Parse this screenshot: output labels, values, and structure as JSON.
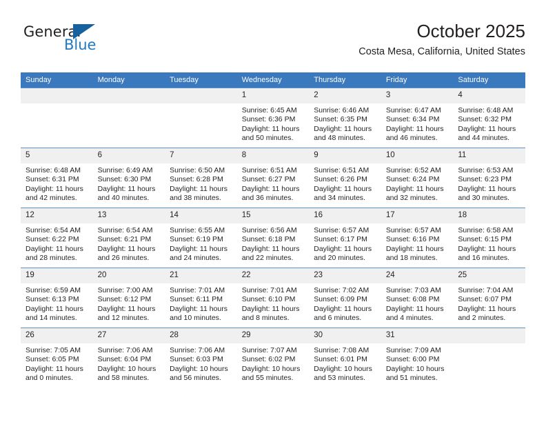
{
  "brand": {
    "name_top": "General",
    "name_bottom": "Blue",
    "triangle_color": "#17619f",
    "blue_color": "#1f7ac4"
  },
  "header": {
    "title": "October 2025",
    "subtitle": "Costa Mesa, California, United States",
    "header_bg": "#3a79bd",
    "daynum_bg": "#f0f0f0"
  },
  "weekday_headers": [
    "Sunday",
    "Monday",
    "Tuesday",
    "Wednesday",
    "Thursday",
    "Friday",
    "Saturday"
  ],
  "weeks": [
    [
      {
        "day": "",
        "sunrise": "",
        "sunset": "",
        "daylight_line1": "",
        "daylight_line2": ""
      },
      {
        "day": "",
        "sunrise": "",
        "sunset": "",
        "daylight_line1": "",
        "daylight_line2": ""
      },
      {
        "day": "",
        "sunrise": "",
        "sunset": "",
        "daylight_line1": "",
        "daylight_line2": ""
      },
      {
        "day": "1",
        "sunrise": "Sunrise: 6:45 AM",
        "sunset": "Sunset: 6:36 PM",
        "daylight_line1": "Daylight: 11 hours",
        "daylight_line2": "and 50 minutes."
      },
      {
        "day": "2",
        "sunrise": "Sunrise: 6:46 AM",
        "sunset": "Sunset: 6:35 PM",
        "daylight_line1": "Daylight: 11 hours",
        "daylight_line2": "and 48 minutes."
      },
      {
        "day": "3",
        "sunrise": "Sunrise: 6:47 AM",
        "sunset": "Sunset: 6:34 PM",
        "daylight_line1": "Daylight: 11 hours",
        "daylight_line2": "and 46 minutes."
      },
      {
        "day": "4",
        "sunrise": "Sunrise: 6:48 AM",
        "sunset": "Sunset: 6:32 PM",
        "daylight_line1": "Daylight: 11 hours",
        "daylight_line2": "and 44 minutes."
      }
    ],
    [
      {
        "day": "5",
        "sunrise": "Sunrise: 6:48 AM",
        "sunset": "Sunset: 6:31 PM",
        "daylight_line1": "Daylight: 11 hours",
        "daylight_line2": "and 42 minutes."
      },
      {
        "day": "6",
        "sunrise": "Sunrise: 6:49 AM",
        "sunset": "Sunset: 6:30 PM",
        "daylight_line1": "Daylight: 11 hours",
        "daylight_line2": "and 40 minutes."
      },
      {
        "day": "7",
        "sunrise": "Sunrise: 6:50 AM",
        "sunset": "Sunset: 6:28 PM",
        "daylight_line1": "Daylight: 11 hours",
        "daylight_line2": "and 38 minutes."
      },
      {
        "day": "8",
        "sunrise": "Sunrise: 6:51 AM",
        "sunset": "Sunset: 6:27 PM",
        "daylight_line1": "Daylight: 11 hours",
        "daylight_line2": "and 36 minutes."
      },
      {
        "day": "9",
        "sunrise": "Sunrise: 6:51 AM",
        "sunset": "Sunset: 6:26 PM",
        "daylight_line1": "Daylight: 11 hours",
        "daylight_line2": "and 34 minutes."
      },
      {
        "day": "10",
        "sunrise": "Sunrise: 6:52 AM",
        "sunset": "Sunset: 6:24 PM",
        "daylight_line1": "Daylight: 11 hours",
        "daylight_line2": "and 32 minutes."
      },
      {
        "day": "11",
        "sunrise": "Sunrise: 6:53 AM",
        "sunset": "Sunset: 6:23 PM",
        "daylight_line1": "Daylight: 11 hours",
        "daylight_line2": "and 30 minutes."
      }
    ],
    [
      {
        "day": "12",
        "sunrise": "Sunrise: 6:54 AM",
        "sunset": "Sunset: 6:22 PM",
        "daylight_line1": "Daylight: 11 hours",
        "daylight_line2": "and 28 minutes."
      },
      {
        "day": "13",
        "sunrise": "Sunrise: 6:54 AM",
        "sunset": "Sunset: 6:21 PM",
        "daylight_line1": "Daylight: 11 hours",
        "daylight_line2": "and 26 minutes."
      },
      {
        "day": "14",
        "sunrise": "Sunrise: 6:55 AM",
        "sunset": "Sunset: 6:19 PM",
        "daylight_line1": "Daylight: 11 hours",
        "daylight_line2": "and 24 minutes."
      },
      {
        "day": "15",
        "sunrise": "Sunrise: 6:56 AM",
        "sunset": "Sunset: 6:18 PM",
        "daylight_line1": "Daylight: 11 hours",
        "daylight_line2": "and 22 minutes."
      },
      {
        "day": "16",
        "sunrise": "Sunrise: 6:57 AM",
        "sunset": "Sunset: 6:17 PM",
        "daylight_line1": "Daylight: 11 hours",
        "daylight_line2": "and 20 minutes."
      },
      {
        "day": "17",
        "sunrise": "Sunrise: 6:57 AM",
        "sunset": "Sunset: 6:16 PM",
        "daylight_line1": "Daylight: 11 hours",
        "daylight_line2": "and 18 minutes."
      },
      {
        "day": "18",
        "sunrise": "Sunrise: 6:58 AM",
        "sunset": "Sunset: 6:15 PM",
        "daylight_line1": "Daylight: 11 hours",
        "daylight_line2": "and 16 minutes."
      }
    ],
    [
      {
        "day": "19",
        "sunrise": "Sunrise: 6:59 AM",
        "sunset": "Sunset: 6:13 PM",
        "daylight_line1": "Daylight: 11 hours",
        "daylight_line2": "and 14 minutes."
      },
      {
        "day": "20",
        "sunrise": "Sunrise: 7:00 AM",
        "sunset": "Sunset: 6:12 PM",
        "daylight_line1": "Daylight: 11 hours",
        "daylight_line2": "and 12 minutes."
      },
      {
        "day": "21",
        "sunrise": "Sunrise: 7:01 AM",
        "sunset": "Sunset: 6:11 PM",
        "daylight_line1": "Daylight: 11 hours",
        "daylight_line2": "and 10 minutes."
      },
      {
        "day": "22",
        "sunrise": "Sunrise: 7:01 AM",
        "sunset": "Sunset: 6:10 PM",
        "daylight_line1": "Daylight: 11 hours",
        "daylight_line2": "and 8 minutes."
      },
      {
        "day": "23",
        "sunrise": "Sunrise: 7:02 AM",
        "sunset": "Sunset: 6:09 PM",
        "daylight_line1": "Daylight: 11 hours",
        "daylight_line2": "and 6 minutes."
      },
      {
        "day": "24",
        "sunrise": "Sunrise: 7:03 AM",
        "sunset": "Sunset: 6:08 PM",
        "daylight_line1": "Daylight: 11 hours",
        "daylight_line2": "and 4 minutes."
      },
      {
        "day": "25",
        "sunrise": "Sunrise: 7:04 AM",
        "sunset": "Sunset: 6:07 PM",
        "daylight_line1": "Daylight: 11 hours",
        "daylight_line2": "and 2 minutes."
      }
    ],
    [
      {
        "day": "26",
        "sunrise": "Sunrise: 7:05 AM",
        "sunset": "Sunset: 6:05 PM",
        "daylight_line1": "Daylight: 11 hours",
        "daylight_line2": "and 0 minutes."
      },
      {
        "day": "27",
        "sunrise": "Sunrise: 7:06 AM",
        "sunset": "Sunset: 6:04 PM",
        "daylight_line1": "Daylight: 10 hours",
        "daylight_line2": "and 58 minutes."
      },
      {
        "day": "28",
        "sunrise": "Sunrise: 7:06 AM",
        "sunset": "Sunset: 6:03 PM",
        "daylight_line1": "Daylight: 10 hours",
        "daylight_line2": "and 56 minutes."
      },
      {
        "day": "29",
        "sunrise": "Sunrise: 7:07 AM",
        "sunset": "Sunset: 6:02 PM",
        "daylight_line1": "Daylight: 10 hours",
        "daylight_line2": "and 55 minutes."
      },
      {
        "day": "30",
        "sunrise": "Sunrise: 7:08 AM",
        "sunset": "Sunset: 6:01 PM",
        "daylight_line1": "Daylight: 10 hours",
        "daylight_line2": "and 53 minutes."
      },
      {
        "day": "31",
        "sunrise": "Sunrise: 7:09 AM",
        "sunset": "Sunset: 6:00 PM",
        "daylight_line1": "Daylight: 10 hours",
        "daylight_line2": "and 51 minutes."
      },
      {
        "day": "",
        "sunrise": "",
        "sunset": "",
        "daylight_line1": "",
        "daylight_line2": ""
      }
    ]
  ]
}
